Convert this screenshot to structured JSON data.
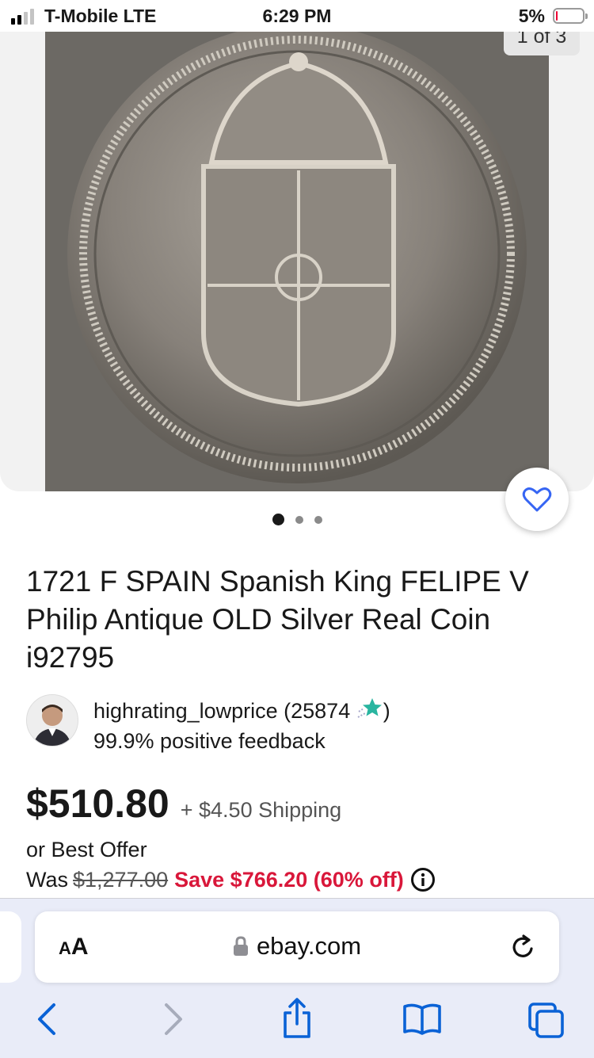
{
  "status_bar": {
    "carrier": "T-Mobile  LTE",
    "time": "6:29 PM",
    "battery": "5%",
    "battery_level": 0.05
  },
  "gallery": {
    "counter": "1 of 3",
    "image_count": 3,
    "active_index": 0
  },
  "listing": {
    "title": "1721 F SPAIN  Spanish King FELIPE V Philip Antique OLD Silver Real Coin i92795",
    "seller": {
      "name": "highrating_lowprice (25874",
      "name_suffix": ")",
      "feedback": "99.9% positive feedback"
    },
    "price": "$510.80",
    "shipping": "+ $4.50 Shipping",
    "best_offer": "or Best Offer",
    "was_label": "Was",
    "was_price": "$1,277.00",
    "savings": "Save $766.20 (60% off)"
  },
  "browser": {
    "text_size_label": "AA",
    "url": "ebay.com"
  },
  "colors": {
    "accent_blue": "#3665f3",
    "savings_red": "#d9173a",
    "ios_blue": "#0a62d6"
  }
}
